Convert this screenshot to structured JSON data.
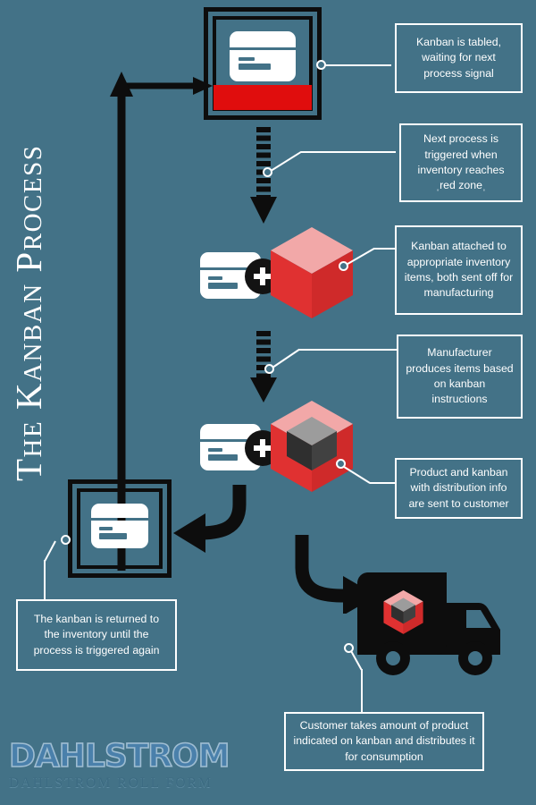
{
  "poster": {
    "title": "The Kanban Process",
    "background_color": "#437287",
    "accent_red": "#e03131",
    "dark": "#0d0d0d",
    "white": "#ffffff"
  },
  "callouts": [
    {
      "id": "callout-1",
      "text": "Kanban is tabled, waiting for next process signal"
    },
    {
      "id": "callout-2",
      "text": "Next process is triggered when inventory reaches ˌred zoneˌ"
    },
    {
      "id": "callout-3",
      "text": "Kanban attached to appropriate inventory items, both sent off for manufacturing"
    },
    {
      "id": "callout-4",
      "text": "Manufacturer produces items based on kanban instructions"
    },
    {
      "id": "callout-5",
      "text": "Product and kanban with distribution info are sent to customer"
    },
    {
      "id": "callout-6",
      "text": "The kanban is returned to the inventory until the process is triggered again"
    },
    {
      "id": "callout-7",
      "text": "Customer takes amount of product indicated on kanban and distributes it for consumption"
    }
  ],
  "logo": {
    "name": "DAHLSTROM",
    "tagline": "DAHLSTROM ROLL FORM"
  },
  "icons": {
    "inventory_box_full": "kanban-box-red-zone-icon",
    "inventory_box_empty": "kanban-box-icon",
    "kanban_card": "kanban-card-icon",
    "plus": "plus-icon",
    "cube": "product-cube-icon",
    "cube_with_items": "product-cube-with-items-icon",
    "truck": "delivery-truck-icon",
    "dashed_arrow": "dashed-down-arrow-icon",
    "curved_arrow": "curved-arrow-icon",
    "return_arrow": "return-loop-arrow-icon"
  }
}
